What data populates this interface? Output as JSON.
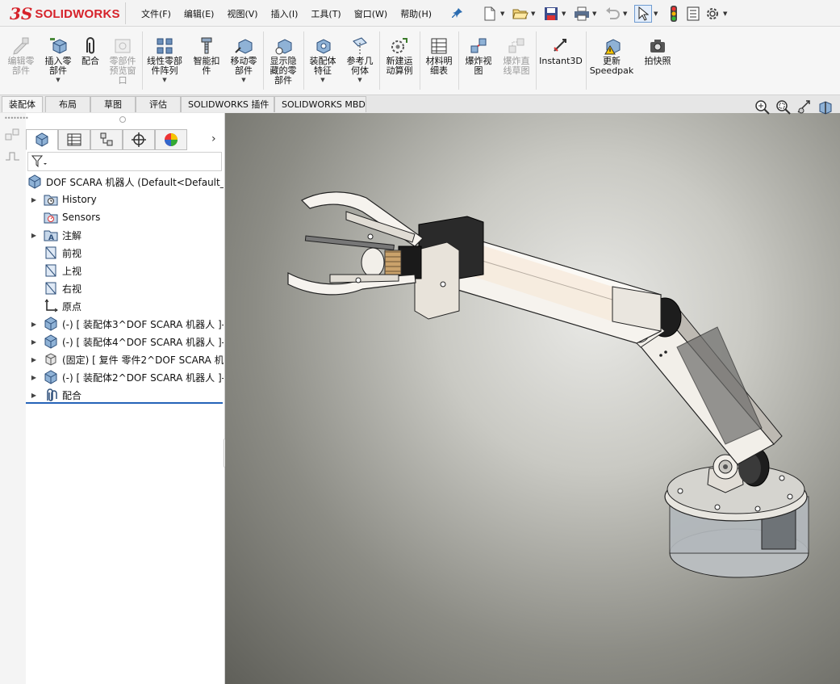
{
  "app": {
    "logo_ds": "3S",
    "logo_text": "SOLIDWORKS"
  },
  "menu": [
    {
      "label": "文件(F)"
    },
    {
      "label": "编辑(E)"
    },
    {
      "label": "视图(V)"
    },
    {
      "label": "插入(I)"
    },
    {
      "label": "工具(T)"
    },
    {
      "label": "窗口(W)"
    },
    {
      "label": "帮助(H)"
    }
  ],
  "quick_access": [
    {
      "icon": "new-document-icon"
    },
    {
      "icon": "open-folder-icon"
    },
    {
      "icon": "save-icon"
    },
    {
      "icon": "print-icon"
    },
    {
      "icon": "undo-icon"
    },
    {
      "icon": "select-pointer-icon"
    },
    {
      "icon": "rebuild-traffic-light-icon"
    },
    {
      "icon": "file-properties-icon"
    },
    {
      "icon": "options-gear-icon"
    }
  ],
  "ribbon": {
    "edit_component": {
      "label": "编辑零部件",
      "enabled": false
    },
    "insert_component": {
      "label": "插入零部件",
      "enabled": true
    },
    "mate": {
      "label": "配合",
      "enabled": true
    },
    "component_preview": {
      "label": "零部件预览窗口",
      "enabled": false
    },
    "linear_pattern": {
      "label": "线性零部件阵列",
      "enabled": true
    },
    "smart_fasteners": {
      "label": "智能扣件",
      "enabled": true
    },
    "move_component": {
      "label": "移动零部件",
      "enabled": true
    },
    "show_hidden": {
      "label": "显示隐藏的零部件",
      "enabled": true
    },
    "assembly_features": {
      "label": "装配体特征",
      "enabled": true
    },
    "reference_geometry": {
      "label": "参考几何体",
      "enabled": true
    },
    "new_motion_study": {
      "label": "新建运动算例",
      "enabled": true
    },
    "bom": {
      "label": "材料明细表",
      "enabled": true
    },
    "exploded_view": {
      "label": "爆炸视图",
      "enabled": true
    },
    "explode_line_sketch": {
      "label": "爆炸直线草图",
      "enabled": false
    },
    "instant3d": {
      "label": "Instant3D",
      "enabled": true
    },
    "update_speedpak": {
      "label": "更新Speedpak",
      "enabled": true
    },
    "snapshot": {
      "label": "拍快照",
      "enabled": true
    }
  },
  "cm_tabs": [
    {
      "label": "装配体",
      "active": true
    },
    {
      "label": "布局",
      "active": false
    },
    {
      "label": "草图",
      "active": false
    },
    {
      "label": "评估",
      "active": false
    },
    {
      "label": "SOLIDWORKS 插件",
      "active": false
    },
    {
      "label": "SOLIDWORKS MBD",
      "active": false
    }
  ],
  "feature_tree": {
    "root": "DOF SCARA 机器人  (Default<Default_D",
    "items": [
      {
        "label": "History",
        "icon": "history-folder-icon",
        "expandable": true
      },
      {
        "label": "Sensors",
        "icon": "sensors-icon",
        "expandable": false
      },
      {
        "label": "注解",
        "icon": "annotations-icon",
        "expandable": true
      },
      {
        "label": "前视",
        "icon": "plane-icon",
        "expandable": false
      },
      {
        "label": "上视",
        "icon": "plane-icon",
        "expandable": false
      },
      {
        "label": "右视",
        "icon": "plane-icon",
        "expandable": false
      },
      {
        "label": "原点",
        "icon": "origin-icon",
        "expandable": false
      },
      {
        "label": "(-) [ 装配体3^DOF SCARA 机器人 ]-",
        "icon": "subassembly-icon",
        "expandable": true
      },
      {
        "label": "(-) [ 装配体4^DOF SCARA 机器人 ]-",
        "icon": "subassembly-icon",
        "expandable": true
      },
      {
        "label": "(固定) [ 复件 零件2^DOF SCARA 机",
        "icon": "part-icon",
        "expandable": true
      },
      {
        "label": "(-) [ 装配体2^DOF SCARA 机器人 ]-",
        "icon": "subassembly-icon",
        "expandable": true
      },
      {
        "label": "配合",
        "icon": "mates-folder-icon",
        "expandable": true
      }
    ]
  },
  "colors": {
    "accent": "#2563b8",
    "brand": "#d6222a"
  }
}
